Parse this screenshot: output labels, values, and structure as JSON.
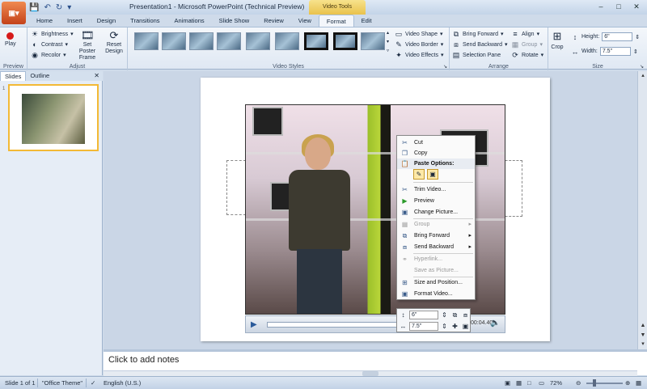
{
  "app": {
    "button_label": "",
    "title": "Presentation1 - Microsoft PowerPoint (Technical Preview)",
    "context_tab": "Video Tools"
  },
  "tabs": [
    {
      "label": "Home"
    },
    {
      "label": "Insert"
    },
    {
      "label": "Design"
    },
    {
      "label": "Transitions"
    },
    {
      "label": "Animations"
    },
    {
      "label": "Slide Show"
    },
    {
      "label": "Review"
    },
    {
      "label": "View"
    },
    {
      "label": "Format"
    },
    {
      "label": "Edit"
    }
  ],
  "ribbon": {
    "preview": {
      "play_label": "Play",
      "group_label": "Preview"
    },
    "adjust": {
      "brightness": "Brightness",
      "contrast": "Contrast",
      "recolor": "Recolor",
      "set_poster_frame": "Set Poster Frame",
      "reset_design": "Reset Design",
      "group_label": "Adjust"
    },
    "video_styles": {
      "video_shape": "Video Shape",
      "video_border": "Video Border",
      "video_effects": "Video Effects",
      "group_label": "Video Styles"
    },
    "arrange": {
      "bring_forward": "Bring Forward",
      "send_backward": "Send Backward",
      "selection_pane": "Selection Pane",
      "align": "Align",
      "group": "Group",
      "rotate": "Rotate",
      "group_label": "Arrange"
    },
    "size": {
      "crop": "Crop",
      "height_label": "Height:",
      "height_value": "6\"",
      "width_label": "Width:",
      "width_value": "7.5\"",
      "group_label": "Size"
    }
  },
  "left_pane": {
    "tab_slides": "Slides",
    "tab_outline": "Outline",
    "slide_number": "1"
  },
  "video_controls": {
    "time": "00:04.40"
  },
  "context_menu": {
    "cut": "Cut",
    "copy": "Copy",
    "paste_options": "Paste Options:",
    "trim_video": "Trim Video...",
    "preview": "Preview",
    "change_picture": "Change Picture...",
    "group": "Group",
    "bring_forward": "Bring Forward",
    "send_backward": "Send Backward",
    "hyperlink": "Hyperlink...",
    "save_as_picture": "Save as Picture...",
    "size_and_position": "Size and Position...",
    "format_video": "Format Video..."
  },
  "mini_toolbar": {
    "height_value": "6\"",
    "width_value": "7.5\""
  },
  "notes": {
    "placeholder": "Click to add notes"
  },
  "status_bar": {
    "slide_info": "Slide 1 of 1",
    "theme": "\"Office Theme\"",
    "language": "English (U.S.)",
    "zoom": "72%"
  }
}
